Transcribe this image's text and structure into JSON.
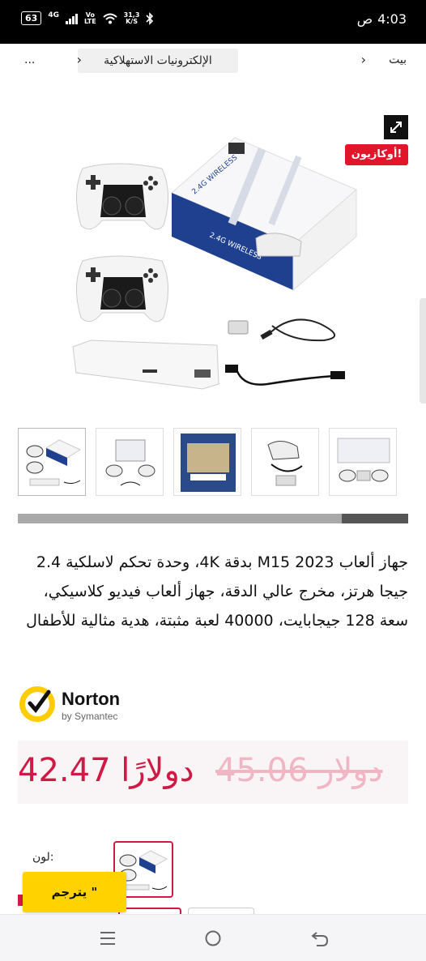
{
  "status_bar": {
    "battery": "63",
    "network": "4G",
    "volte_top": "Vo",
    "volte_bottom": "LTE",
    "speed_top": "31,3",
    "speed_bottom": "K/S",
    "time": "4:03",
    "ampm": "ص"
  },
  "breadcrumb": {
    "home": "بيت",
    "category": "الإلكترونيات الاستهلاكية",
    "more": "..."
  },
  "main_image": {
    "badge": "أوكازيون!",
    "box_label": "2.4G WIRELESS"
  },
  "gallery": {
    "progress_fraction": 0.17
  },
  "product": {
    "title": "جهاز ألعاب M15 2023 بدقة 4K، وحدة تحكم لاسلكية 2.4 جيجا هرتز، مخرج عالي الدقة، جهاز ألعاب فيديو كلاسيكي، سعة 128 جيجابايت، 40000 لعبة مثبتة، هدية مثالية للأطفال"
  },
  "norton": {
    "name": "Norton",
    "by": "by Symantec"
  },
  "price": {
    "current": "42.47 دولارًا",
    "old": "دولار 45.06"
  },
  "options": {
    "color_label": ":لون"
  },
  "translate": {
    "label": "يترجم \""
  },
  "colors": {
    "accent": "#d01a45",
    "badge": "#e3152b",
    "translate_bg": "#ffd200"
  }
}
